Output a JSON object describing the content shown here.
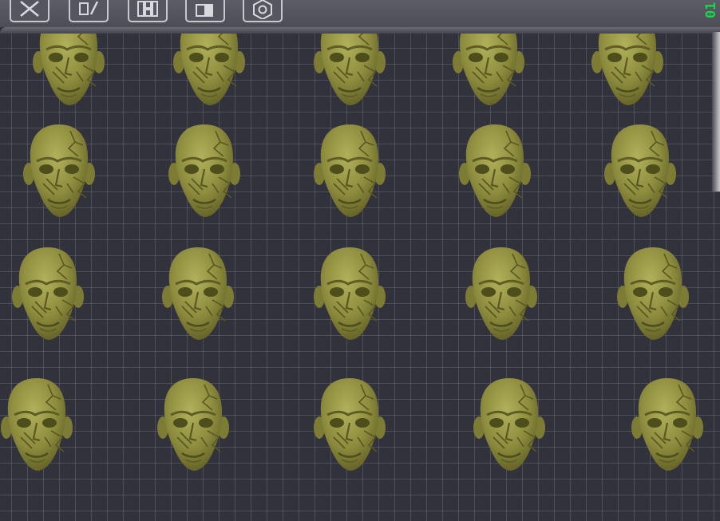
{
  "toolbar": {
    "tools": [
      {
        "name": "delete-tool-button",
        "icon": "close-x-icon"
      },
      {
        "name": "edit-tool-button",
        "icon": "edit-pen-icon"
      },
      {
        "name": "arrange-tool-button",
        "icon": "grid-arrange-icon"
      },
      {
        "name": "split-tool-button",
        "icon": "split-object-icon"
      },
      {
        "name": "settings-tool-button",
        "icon": "hex-nut-settings-icon"
      }
    ],
    "counter": "01"
  },
  "build_plate": {
    "model_name": "skull-head",
    "model_color": "#8f8e3f",
    "model_rows": 4,
    "model_cols": 5,
    "model_count": 20
  },
  "colors": {
    "toolbar_bg": "#55565f",
    "bed_bg": "#32323c",
    "grid_line": "#9696a5",
    "counter_text": "#19d64a",
    "model_fill": "#8f8e3f"
  }
}
